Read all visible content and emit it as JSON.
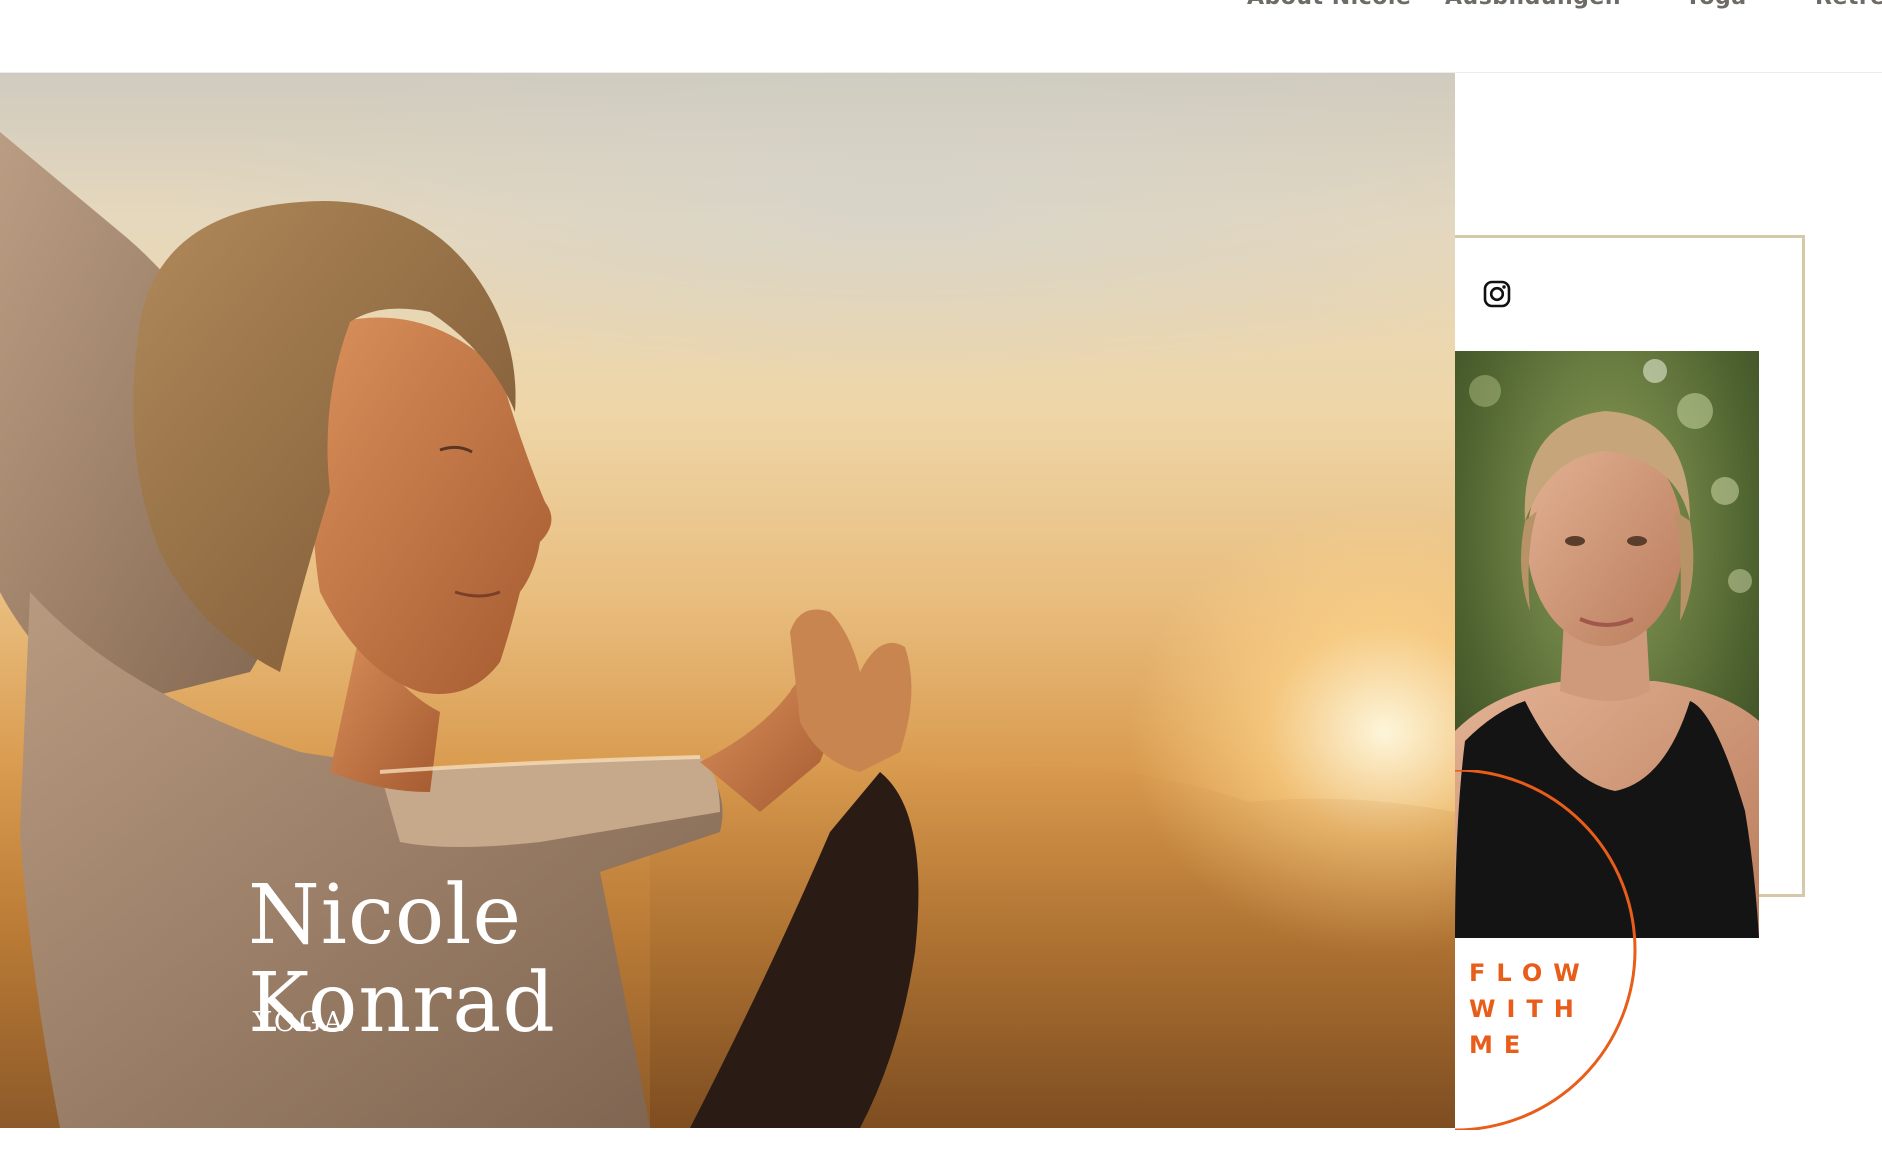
{
  "nav": {
    "items": [
      {
        "label": "About Nicole"
      },
      {
        "label": "Ausbildungen"
      },
      {
        "label": "Yoga"
      },
      {
        "label": "Retre"
      }
    ]
  },
  "hero": {
    "title_line1": "Nicole",
    "title_line2": "Konrad",
    "subtitle": "YOGA"
  },
  "side": {
    "social_icon": "instagram-icon",
    "tagline": [
      "FLOW",
      "WITH",
      "ME"
    ]
  },
  "colors": {
    "accent": "#e85d19",
    "frame": "#d6c9aa",
    "nav_text": "#6e6a66"
  }
}
